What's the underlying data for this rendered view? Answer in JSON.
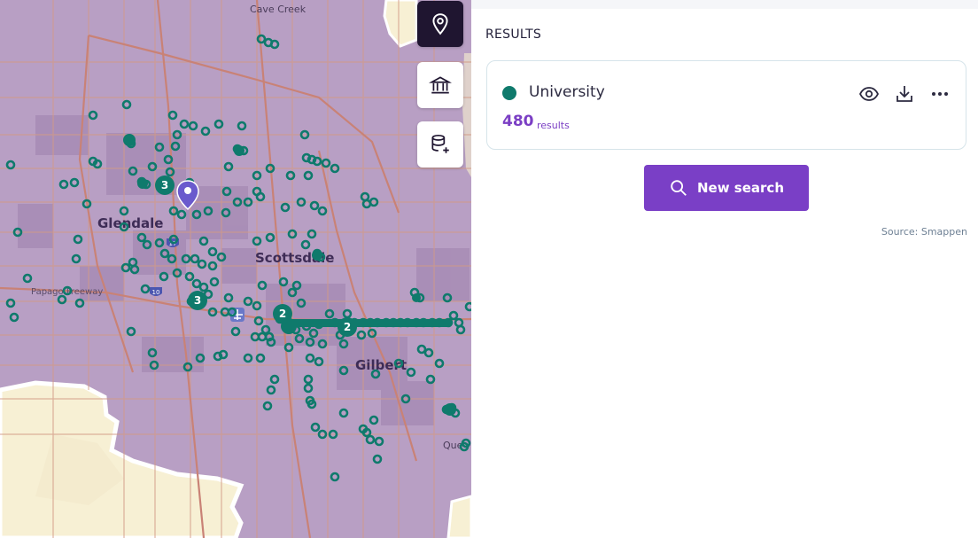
{
  "map": {
    "cities": {
      "cave_creek": "Cave Creek",
      "glendale": "Glendale",
      "scottsdale": "Scottsdale",
      "gilbert": "Gilbert",
      "queen_creek_partial": "Que"
    },
    "roads": {
      "papago_freeway": "Papago Freeway",
      "i17": "17",
      "i10": "10"
    },
    "clusters": [
      "3",
      "3",
      "2",
      "2"
    ],
    "controls": {
      "location": "location-pin-icon",
      "institution": "institution-icon",
      "add_data": "database-plus-icon"
    },
    "colors": {
      "overlay": "#b89fc4",
      "marker": "#0f7a6c",
      "pin": "#6a5acd",
      "desert": "#f7f0d4"
    }
  },
  "panel": {
    "heading": "RESULTS",
    "result": {
      "name": "University",
      "count": "480",
      "count_label": "results",
      "dot_color": "#0f7a6c"
    },
    "card_icons": [
      "eye-icon",
      "download-icon",
      "more-icon"
    ],
    "new_search_label": "New search",
    "source": "Source: Smappen",
    "accent_color": "#7a3fc6"
  }
}
